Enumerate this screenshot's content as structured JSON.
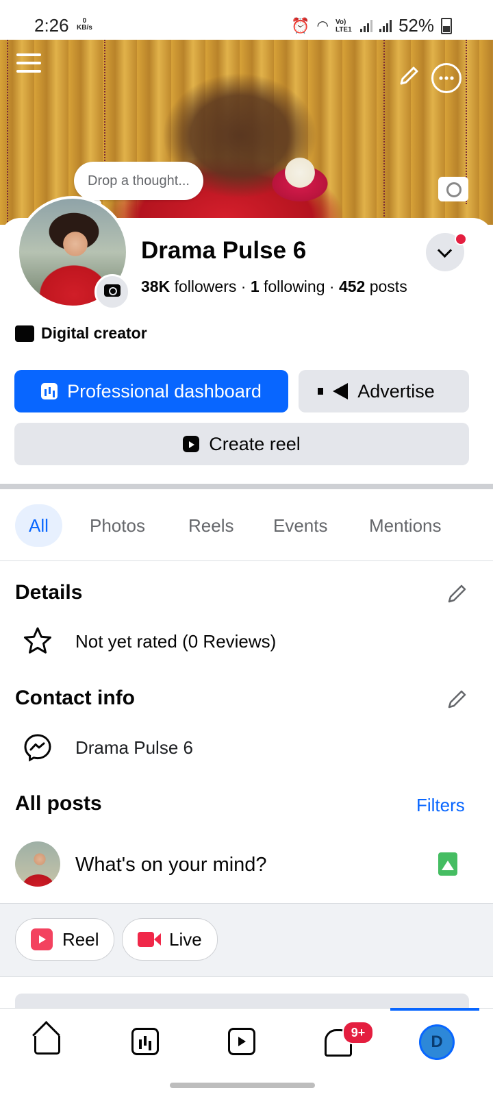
{
  "status_bar": {
    "time": "2:26",
    "speed_value": "0",
    "speed_unit": "KB/s",
    "network": "Vo) LTE1",
    "battery": "52%"
  },
  "profile": {
    "thought_placeholder": "Drop a thought...",
    "name": "Drama Pulse 6",
    "followers_count": "38K",
    "followers_label": "followers",
    "following_count": "1",
    "following_label": "following",
    "posts_count": "452",
    "posts_label": "posts",
    "category": "Digital creator"
  },
  "actions": {
    "professional_dashboard": "Professional dashboard",
    "advertise": "Advertise",
    "create_reel": "Create reel"
  },
  "tabs": [
    {
      "label": "All",
      "active": true
    },
    {
      "label": "Photos",
      "active": false
    },
    {
      "label": "Reels",
      "active": false
    },
    {
      "label": "Events",
      "active": false
    },
    {
      "label": "Mentions",
      "active": false
    }
  ],
  "details": {
    "title": "Details",
    "rating": "Not yet rated (0 Reviews)"
  },
  "contact": {
    "title": "Contact info",
    "messenger": "Drama Pulse 6"
  },
  "posts": {
    "title": "All posts",
    "filters": "Filters",
    "composer_placeholder": "What's on your mind?",
    "chips": [
      "Reel",
      "Live"
    ]
  },
  "bottom_nav": {
    "notification_badge": "9+",
    "profile_initial": "D"
  },
  "colors": {
    "primary": "#0866ff",
    "badge": "#e41e3f",
    "secondary_button": "#e4e6eb"
  }
}
